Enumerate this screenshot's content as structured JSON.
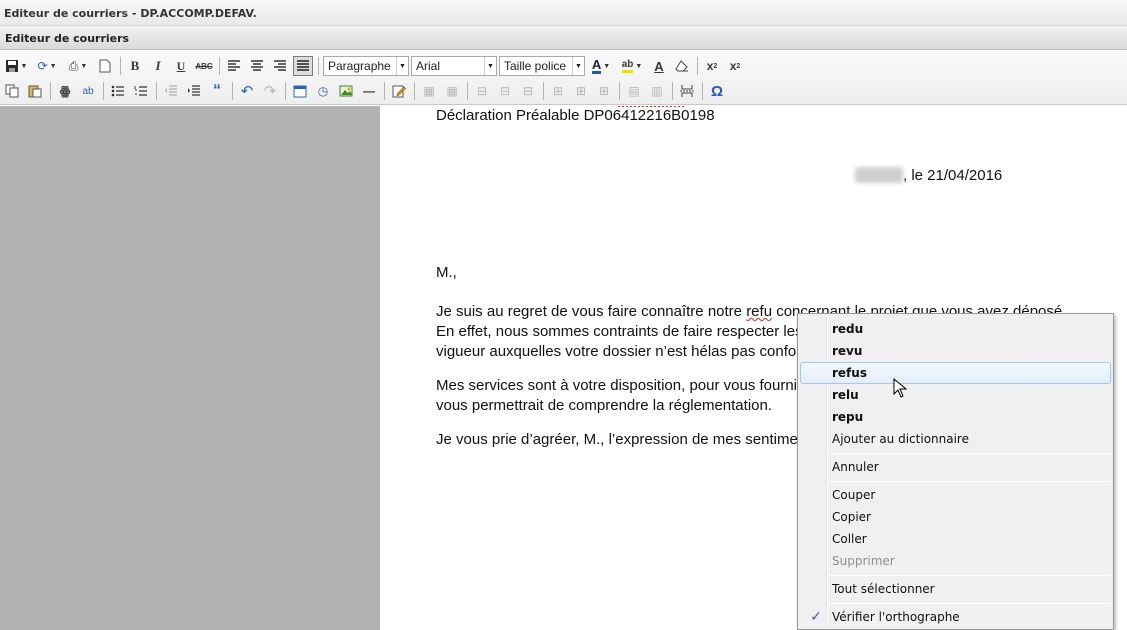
{
  "window": {
    "title": "Editeur de courriers - DP.ACCOMP.DEFAV."
  },
  "panel": {
    "title": "Editeur de courriers"
  },
  "toolbar": {
    "format_select": "Paragraphe",
    "font_select": "Arial",
    "size_select": "Taille police",
    "bold_label": "B",
    "italic_label": "I",
    "underline_label": "U",
    "strike_label": "ABC",
    "sub_label": "x",
    "sup_label": "x",
    "omega_label": "Ω"
  },
  "document": {
    "line_header": "Déclaration Préalable DP06412216B0198",
    "line_date": ", le 21/04/2016",
    "salutation": "M.,",
    "p1_l1_before": "Je suis au regret de vous faire connaître notre ",
    "p1_l1_word": "refu",
    "p1_l1_after": " concernant le projet que vous avez déposé.",
    "p1_l2": "En effet, nous sommes contraints de faire respecter les règles d'urbanisme en",
    "p1_l3": "vigueur auxquelles votre dossier n’est hélas pas conforme.",
    "p2_l1": "Mes services sont à votre disposition, pour vous fournir toute information qui",
    "p2_l2": "vous permettrait de comprendre la réglementation.",
    "p3_l1": "Je vous prie d’agréer, M., l’expression de mes sentiments distingués."
  },
  "context_menu": {
    "suggestions": [
      "redu",
      "revu",
      "refus",
      "relu",
      "repu"
    ],
    "add_dictionary": "Ajouter au dictionnaire",
    "undo": "Annuler",
    "cut": "Couper",
    "copy": "Copier",
    "paste": "Coller",
    "delete": "Supprimer",
    "select_all": "Tout sélectionner",
    "spellcheck": "Vérifier l'orthographe",
    "check_mark": "✓",
    "highlighted_item": "refus"
  }
}
